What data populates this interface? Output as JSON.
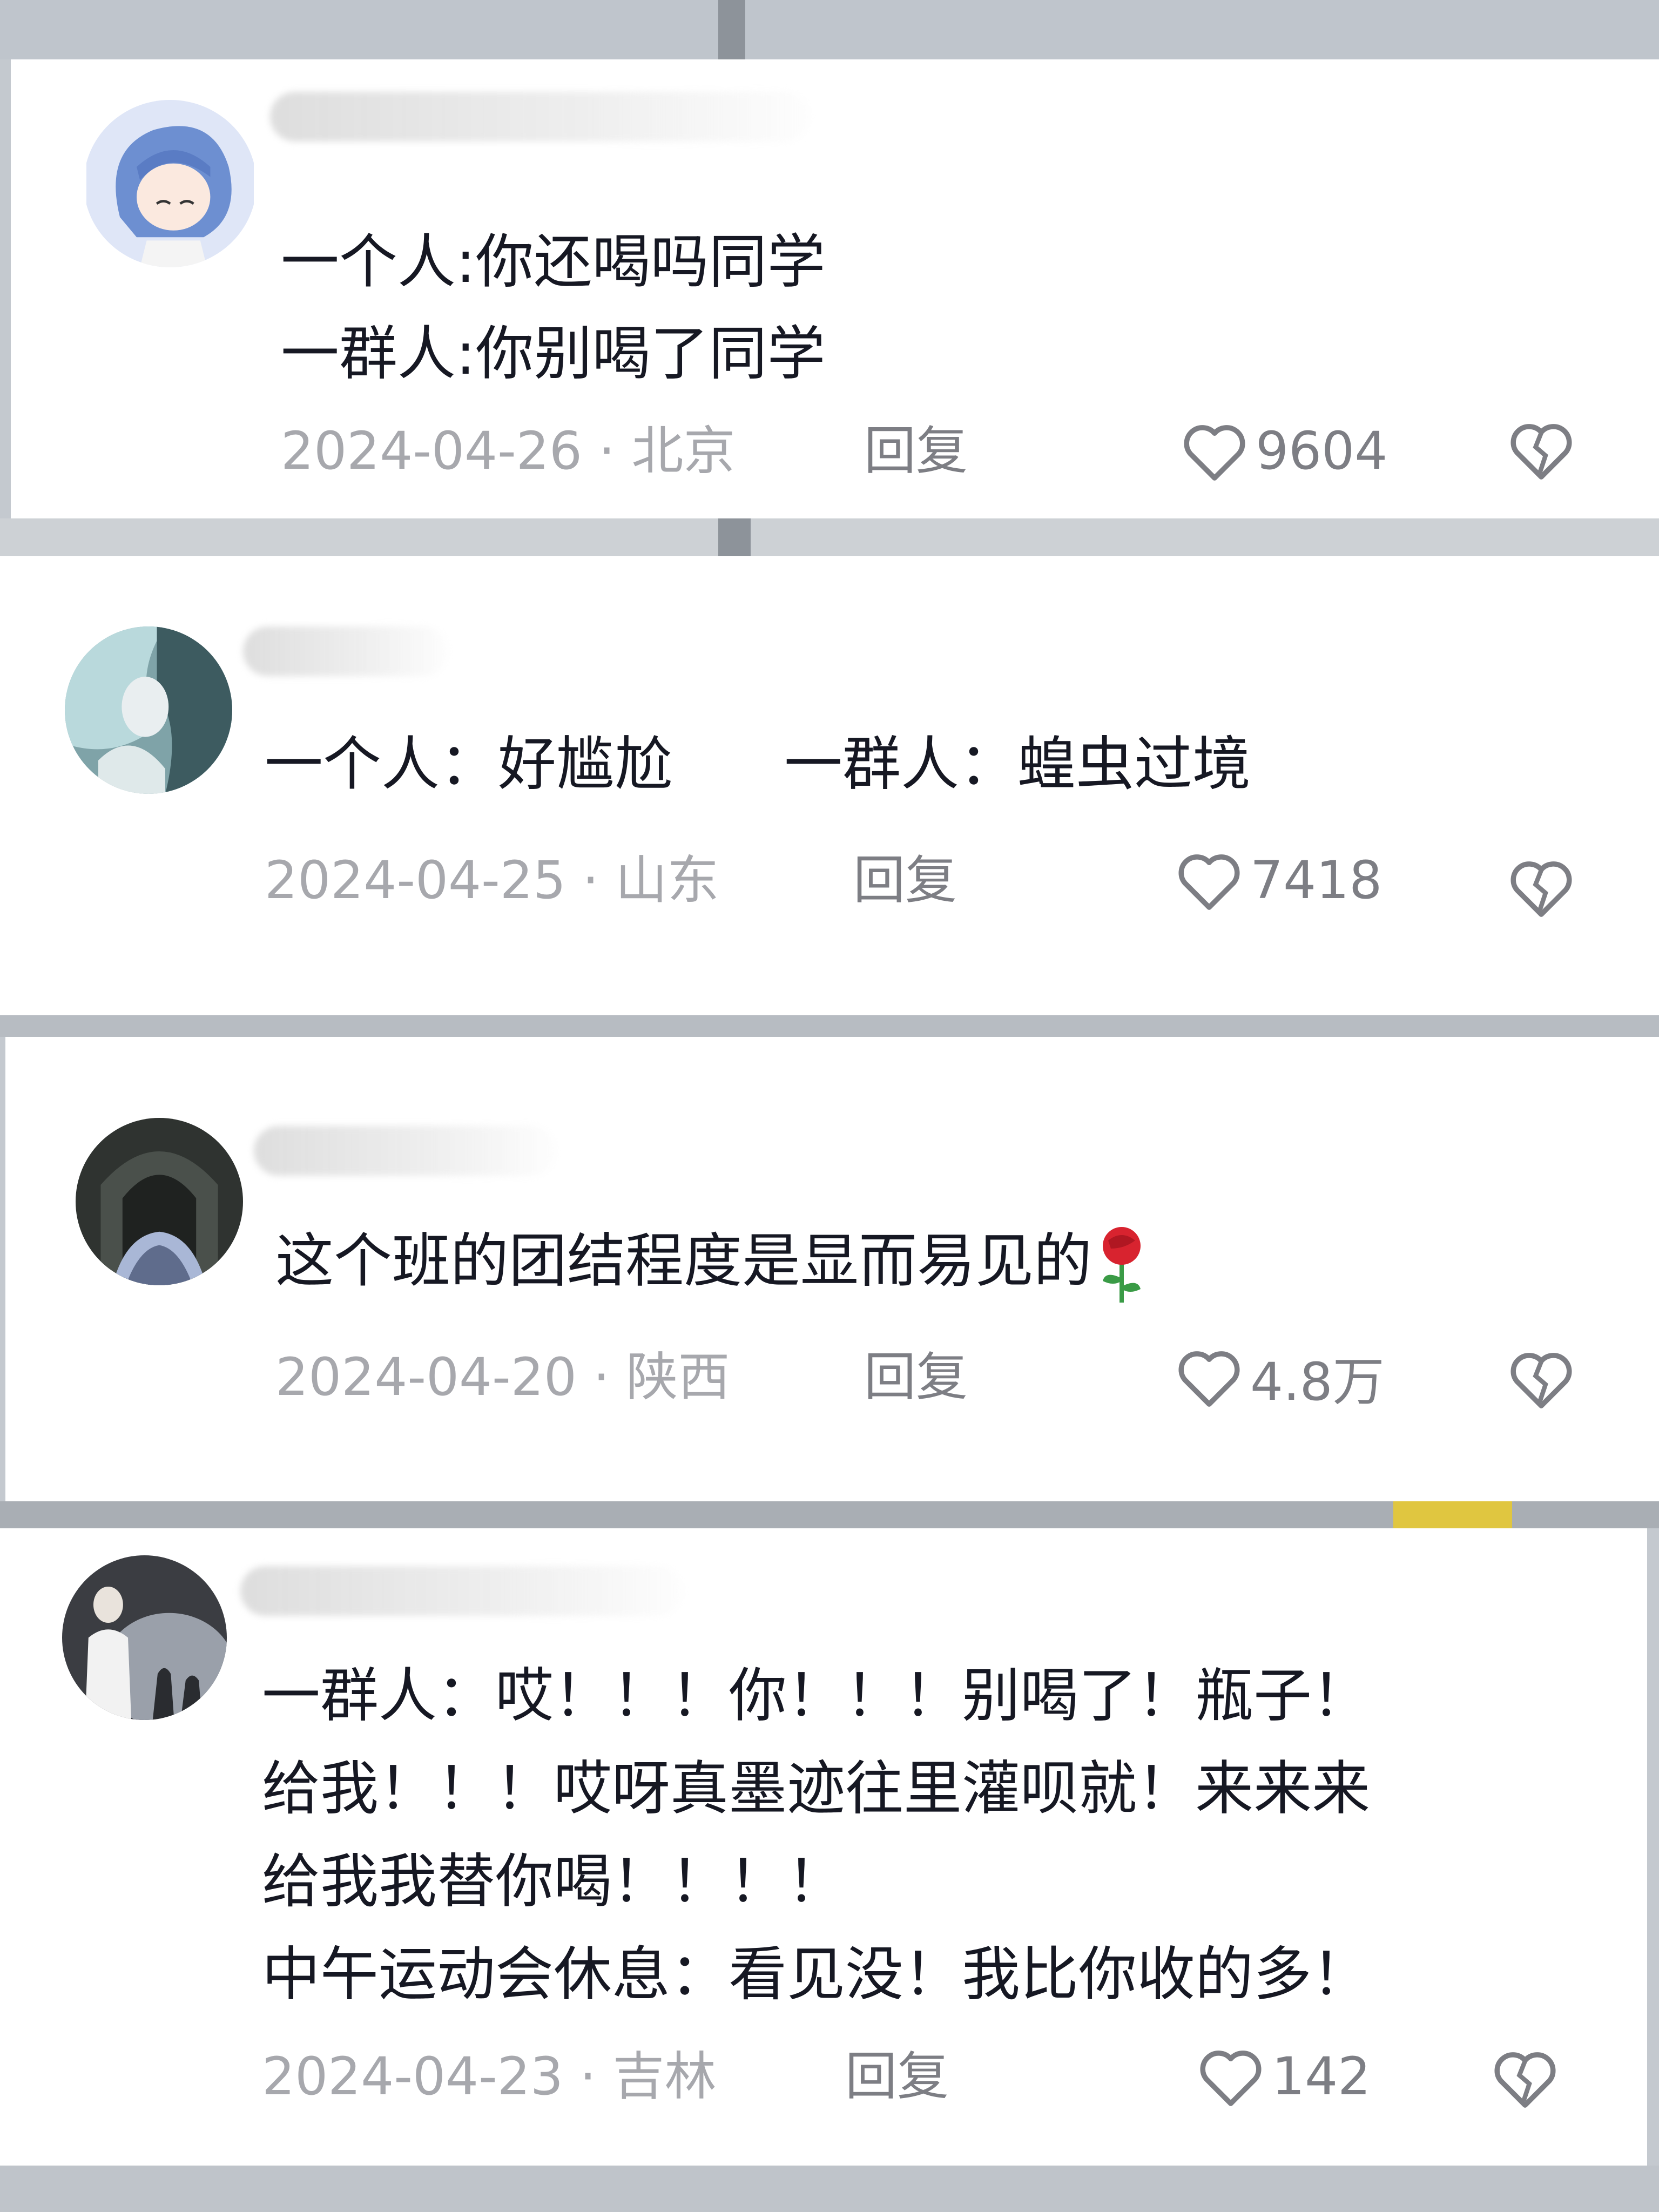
{
  "comments": [
    {
      "lines": [
        "一个人:你还喝吗同学",
        "一群人:你别喝了同学"
      ],
      "date": "2024-04-26",
      "location": "北京",
      "reply_label": "回复",
      "likes": "9604"
    },
    {
      "lines": [
        "一个人：好尴尬      一群人：蝗虫过境"
      ],
      "date": "2024-04-25",
      "location": "山东",
      "reply_label": "回复",
      "likes": "7418"
    },
    {
      "lines": [
        "这个班的团结程度是显而易见的"
      ],
      "emoji": "rose-emoji",
      "date": "2024-04-20",
      "location": "陕西",
      "reply_label": "回复",
      "likes": "4.8万"
    },
    {
      "lines": [
        "一群人：哎！！！你！！！别喝了！瓶子！",
        "给我！！！哎呀真墨迹往里灌呗就！来来来",
        "给我我替你喝！！！！",
        "中午运动会休息：看见没！我比你收的多！"
      ],
      "date": "2024-04-23",
      "location": "吉林",
      "reply_label": "回复",
      "likes": "142"
    }
  ],
  "icons": {
    "like": "heart-outline-icon",
    "dislike": "broken-heart-icon"
  },
  "colors": {
    "text": "#161823",
    "meta": "#a7a8ad",
    "reply": "#7d7e84"
  }
}
